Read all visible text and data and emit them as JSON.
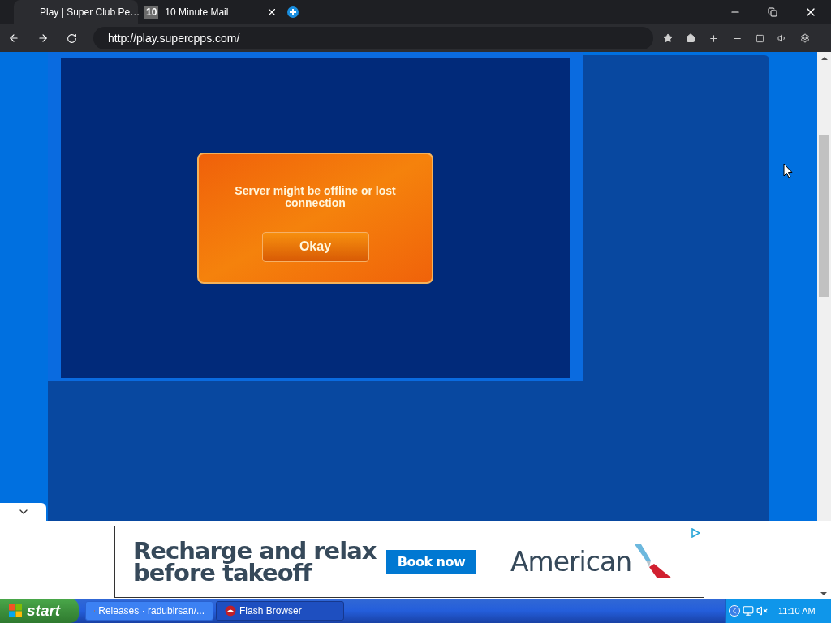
{
  "browser": {
    "tabs": [
      {
        "title": "Play | Super Club Pe…",
        "selected": true
      },
      {
        "title": "10 Minute Mail",
        "favicon": "10",
        "selected": false
      }
    ],
    "address": "http://play.supercpps.com/"
  },
  "game": {
    "dialog": {
      "message": "Server might be offline or lost connection",
      "button": "Okay"
    }
  },
  "ad": {
    "headline": "Recharge and relax before takeoff",
    "button": "Book now",
    "brand": "American"
  },
  "taskbar": {
    "start": "start",
    "tasks": [
      {
        "label": "Releases · radubirsan/...",
        "kind": "chrome",
        "selected": false
      },
      {
        "label": "Flash Browser",
        "kind": "flash",
        "selected": true
      }
    ],
    "clock": "11:10 AM"
  }
}
